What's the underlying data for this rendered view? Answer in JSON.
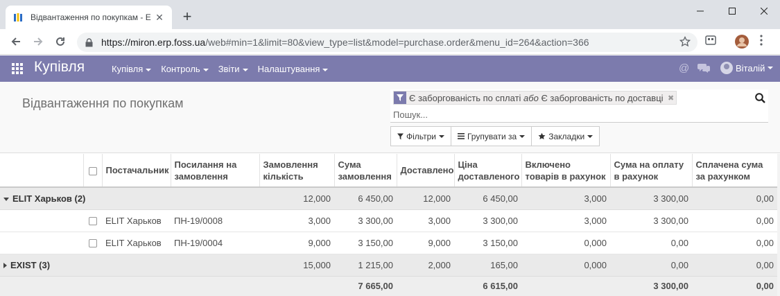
{
  "browser": {
    "tab_title": "Відвантаження по покупкам - E",
    "url_host": "https://miron.erp.foss.ua",
    "url_path": "/web#min=1&limit=80&view_type=list&model=purchase.order&menu_id=264&action=366"
  },
  "app": {
    "title": "Купівля",
    "menu": [
      "Купівля",
      "Контроль",
      "Звіти",
      "Налаштування"
    ],
    "user": "Віталій"
  },
  "control": {
    "breadcrumb": "Відвантаження по покупкам",
    "facet_part1": "Є заборгованість по сплаті ",
    "facet_or": "або",
    "facet_part2": " Є заборгованість по доставці",
    "search_placeholder": "Пошук...",
    "filters_label": "Фільтри",
    "groupby_label": "Групувати за",
    "favorites_label": "Закладки"
  },
  "table": {
    "headers": [
      "Постачальник",
      "Посилання на замовлення",
      "Замовлення кількість",
      "Сума замовлення",
      "Доставлено",
      "Ціна доставленого",
      "Включено товарів в рахунок",
      "Сума на оплату в рахунок",
      "Сплачена сума за рахунком"
    ],
    "group1": {
      "label": "ELIT Харьков (2)",
      "values": [
        "12,000",
        "6 450,00",
        "12,000",
        "6 450,00",
        "3,000",
        "3 300,00",
        "0,00"
      ]
    },
    "rows": [
      {
        "vendor": "ELIT Харьков",
        "ref": "ПН-19/0008",
        "values": [
          "3,000",
          "3 300,00",
          "3,000",
          "3 300,00",
          "3,000",
          "3 300,00",
          "0,00"
        ]
      },
      {
        "vendor": "ELIT Харьков",
        "ref": "ПН-19/0004",
        "values": [
          "9,000",
          "3 150,00",
          "9,000",
          "3 150,00",
          "0,000",
          "0,00",
          "0,00"
        ]
      }
    ],
    "group2": {
      "label": "EXIST (3)",
      "values": [
        "15,000",
        "1 215,00",
        "2,000",
        "165,00",
        "0,000",
        "0,00",
        "0,00"
      ]
    },
    "footer": {
      "order_total": "7 665,00",
      "delivered_total": "6 615,00",
      "invoice_total": "3 300,00",
      "paid_total": "0,00"
    }
  },
  "colors": {
    "brand": "#7c7bad"
  }
}
